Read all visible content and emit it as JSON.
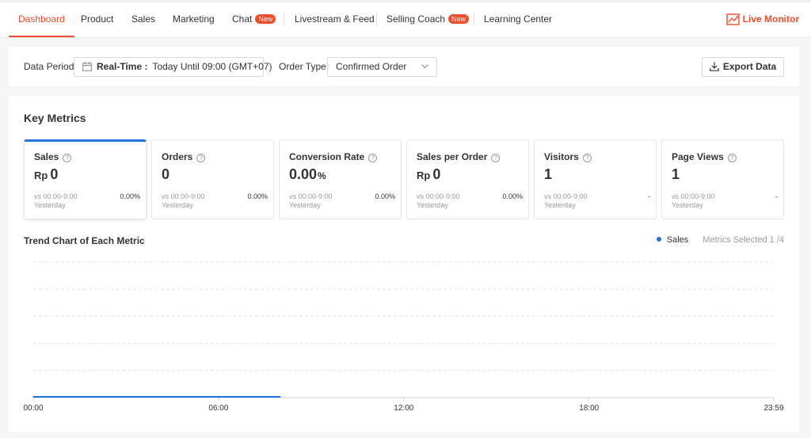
{
  "nav": {
    "items": [
      {
        "label": "Dashboard"
      },
      {
        "label": "Product"
      },
      {
        "label": "Sales"
      },
      {
        "label": "Marketing"
      },
      {
        "label": "Chat",
        "badge": "New"
      },
      {
        "label": "Livestream & Feed"
      },
      {
        "label": "Selling Coach",
        "badge": "New"
      },
      {
        "label": "Learning Center"
      }
    ],
    "live_monitor": "Live Monitor"
  },
  "filter": {
    "data_period_label": "Data Period",
    "date_mode": "Real-Time :",
    "date_range": "Today Until 09:00 (GMT+07)",
    "order_type_label": "Order Type",
    "order_type_value": "Confirmed Order",
    "export_label": "Export Data"
  },
  "key_metrics": {
    "title": "Key Metrics",
    "help_glyph": "?",
    "cards": [
      {
        "name": "Sales",
        "prefix": "Rp",
        "value": "0",
        "suffix": "",
        "cmp_line1": "vs 00:00-9:00",
        "cmp_line2": "Yesterday",
        "change": "0.00%"
      },
      {
        "name": "Orders",
        "prefix": "",
        "value": "0",
        "suffix": "",
        "cmp_line1": "vs 00:00-9:00",
        "cmp_line2": "Yesterday",
        "change": "0.00%"
      },
      {
        "name": "Conversion Rate",
        "prefix": "",
        "value": "0.00",
        "suffix": "%",
        "cmp_line1": "vs 00:00-9:00",
        "cmp_line2": "Yesterday",
        "change": "0.00%"
      },
      {
        "name": "Sales per Order",
        "prefix": "Rp",
        "value": "0",
        "suffix": "",
        "cmp_line1": "vs 00:00-9:00",
        "cmp_line2": "Yesterday",
        "change": "0.00%"
      },
      {
        "name": "Visitors",
        "prefix": "",
        "value": "1",
        "suffix": "",
        "cmp_line1": "vs 00:00-9:00",
        "cmp_line2": "Yesterday",
        "change": "-"
      },
      {
        "name": "Page Views",
        "prefix": "",
        "value": "1",
        "suffix": "",
        "cmp_line1": "vs 00:00-9:00",
        "cmp_line2": "Yesterday",
        "change": "-"
      }
    ]
  },
  "trend": {
    "title": "Trend Chart of Each Metric",
    "legend_series": "Sales",
    "metrics_selected": "Metrics Selected 1 /4"
  },
  "colors": {
    "accent": "#ee4d2d",
    "selected": "#2673dd"
  },
  "chart_data": {
    "type": "line",
    "title": "Trend Chart of Each Metric",
    "xlabel": "",
    "ylabel": "",
    "x_ticks": [
      "00:00",
      "06:00",
      "12:00",
      "18:00",
      "23:59"
    ],
    "x_range_minutes": [
      0,
      1439
    ],
    "ylim": [
      0,
      1
    ],
    "grid": true,
    "legend_position": "top-right",
    "series": [
      {
        "name": "Sales",
        "color": "#2673dd",
        "x": [
          "00:00",
          "01:00",
          "02:00",
          "03:00",
          "04:00",
          "05:00",
          "06:00",
          "07:00",
          "08:00"
        ],
        "values": [
          0,
          0,
          0,
          0,
          0,
          0,
          0,
          0,
          0
        ]
      }
    ]
  }
}
